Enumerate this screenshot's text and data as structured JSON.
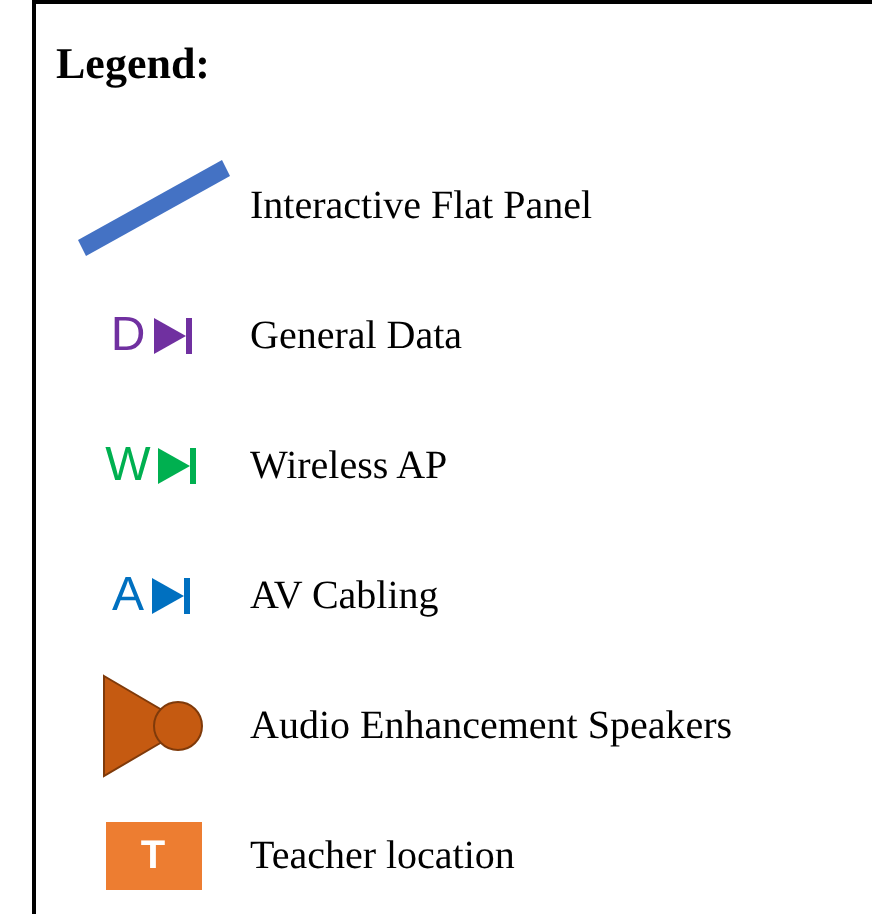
{
  "legend": {
    "title": "Legend:",
    "items": [
      {
        "kind": "panel",
        "label": "Interactive Flat Panel"
      },
      {
        "kind": "port",
        "letter": "D",
        "color": "#7030a0",
        "label": "General Data"
      },
      {
        "kind": "port",
        "letter": "W",
        "color": "#00b050",
        "label": "Wireless AP"
      },
      {
        "kind": "port",
        "letter": "A",
        "color": "#0070c0",
        "label": "AV Cabling"
      },
      {
        "kind": "speaker",
        "label": "Audio Enhancement Speakers"
      },
      {
        "kind": "teacher",
        "letter": "T",
        "label": "Teacher location"
      }
    ]
  }
}
